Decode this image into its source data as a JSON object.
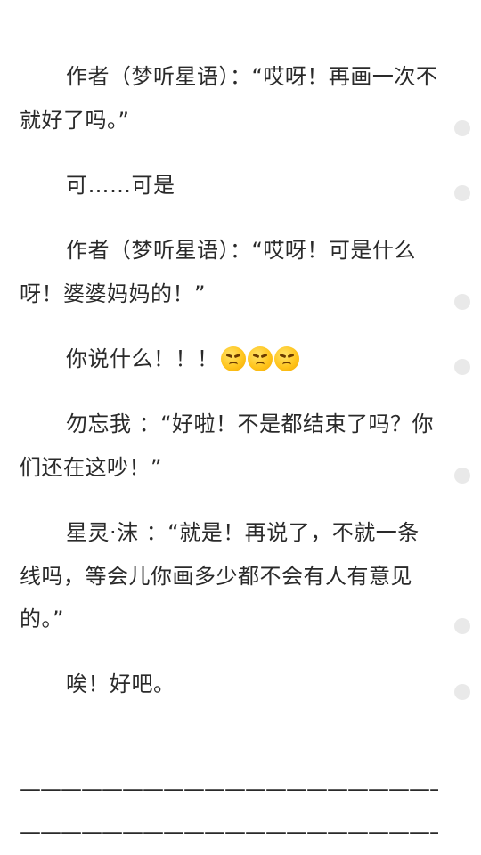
{
  "paragraphs": [
    {
      "text": "作者（梦听星语）：“哎呀！再画一次不就好了吗。”"
    },
    {
      "text": "可……可是"
    },
    {
      "text": "作者（梦听星语）：“哎呀！可是什么呀！婆婆妈妈的！”"
    },
    {
      "text": "你说什么！！！",
      "emojis": [
        "angry-face-icon",
        "angry-face-icon",
        "angry-face-icon"
      ]
    },
    {
      "text": "勿忘我 ：“好啦！不是都结束了吗？你们还在这吵！”"
    },
    {
      "text": "星灵·沫 ：“就是！再说了，不就一条线吗，等会儿你画多少都不会有人有意见的。”"
    },
    {
      "text": "唉！好吧。"
    }
  ],
  "separator_lines": [
    "——————————————————————",
    "——————————————————————"
  ],
  "colors": {
    "text": "#2a2a2a",
    "background": "#ffffff",
    "side_marker": "#e9e9e9",
    "emoji": "#ffc51d"
  }
}
